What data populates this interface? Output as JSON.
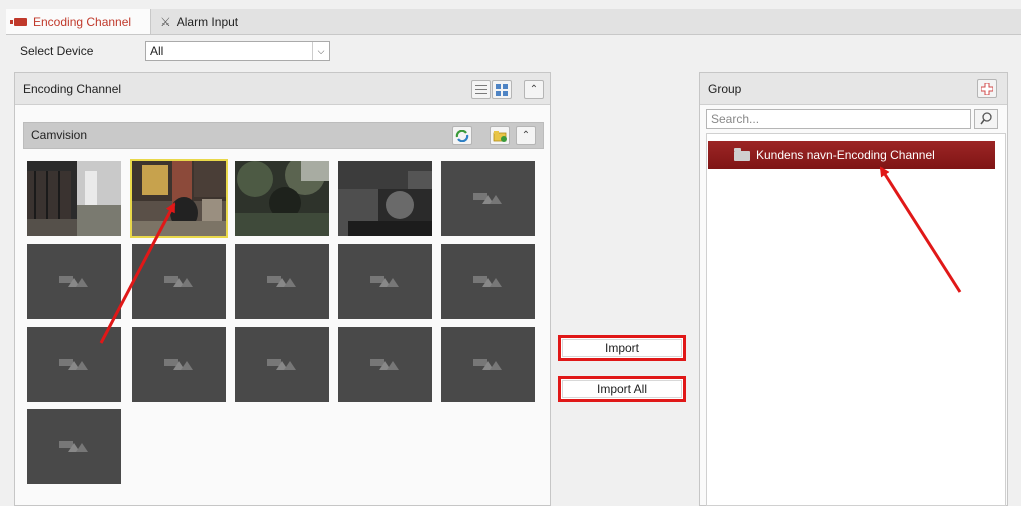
{
  "tabs": [
    {
      "label": "Encoding Channel",
      "icon": "camera-icon",
      "active": true
    },
    {
      "label": "Alarm Input",
      "icon": "alarm-input-icon",
      "active": false
    }
  ],
  "select_device": {
    "label": "Select Device",
    "value": "All"
  },
  "encoding_panel": {
    "title": "Encoding Channel"
  },
  "device_group": {
    "title": "Camvision"
  },
  "channels": [
    {
      "thumb": "live",
      "scene": "fence-yard",
      "selected": false
    },
    {
      "thumb": "live",
      "scene": "garden-bin",
      "selected": true
    },
    {
      "thumb": "live",
      "scene": "trees",
      "selected": false
    },
    {
      "thumb": "live",
      "scene": "night-ir",
      "selected": false
    },
    {
      "thumb": "no-signal",
      "selected": false
    },
    {
      "thumb": "no-signal",
      "selected": false
    },
    {
      "thumb": "no-signal",
      "selected": false
    },
    {
      "thumb": "no-signal",
      "selected": false
    },
    {
      "thumb": "no-signal",
      "selected": false
    },
    {
      "thumb": "no-signal",
      "selected": false
    },
    {
      "thumb": "no-signal",
      "selected": false
    },
    {
      "thumb": "no-signal",
      "selected": false
    },
    {
      "thumb": "no-signal",
      "selected": false
    },
    {
      "thumb": "no-signal",
      "selected": false
    },
    {
      "thumb": "no-signal",
      "selected": false
    },
    {
      "thumb": "no-signal",
      "selected": false
    }
  ],
  "buttons": {
    "import": "Import",
    "import_all": "Import All"
  },
  "group_panel": {
    "title": "Group",
    "search_placeholder": "Search...",
    "items": [
      {
        "label": "Kundens navn-Encoding Channel",
        "selected": true
      }
    ]
  },
  "colors": {
    "accent": "#c0392b",
    "highlight_box": "#e01818",
    "selected_item": "#8b1c1c",
    "arrow": "#e01818"
  }
}
